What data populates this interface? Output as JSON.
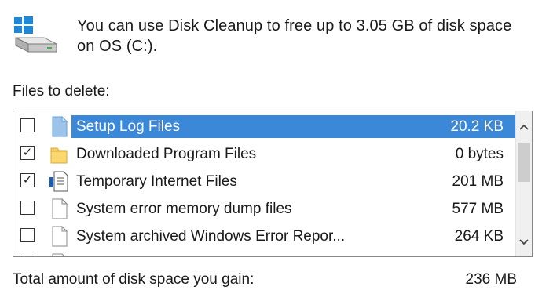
{
  "header": {
    "message": "You can use Disk Cleanup to free up to 3.05 GB of disk space on OS (C:)."
  },
  "files_label": "Files to delete:",
  "files": [
    {
      "label": "Setup Log Files",
      "size": "20.2 KB",
      "checked": false,
      "selected": true,
      "icon": "log-file-icon"
    },
    {
      "label": "Downloaded Program Files",
      "size": "0 bytes",
      "checked": true,
      "selected": false,
      "icon": "folder-icon"
    },
    {
      "label": "Temporary Internet Files",
      "size": "201 MB",
      "checked": true,
      "selected": false,
      "icon": "internet-file-icon"
    },
    {
      "label": "System error memory dump files",
      "size": "577 MB",
      "checked": false,
      "selected": false,
      "icon": "file-icon"
    },
    {
      "label": "System archived Windows Error Repor...",
      "size": "264 KB",
      "checked": false,
      "selected": false,
      "icon": "file-icon"
    }
  ],
  "total": {
    "label": "Total amount of disk space you gain:",
    "value": "236 MB"
  },
  "colors": {
    "selection": "#3b87d8",
    "folder": "#f8cf5a",
    "log_file": "#9cc3ea"
  }
}
